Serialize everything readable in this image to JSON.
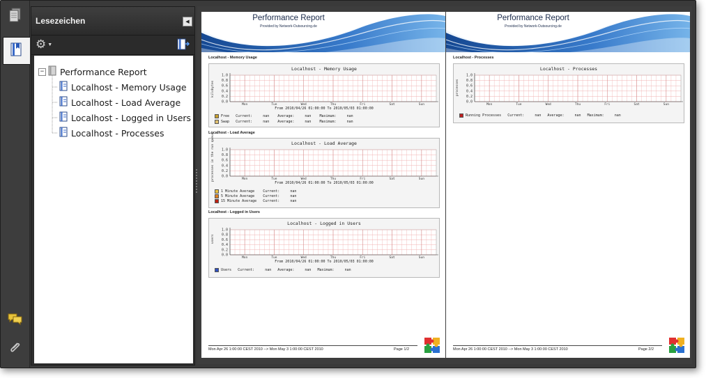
{
  "panel": {
    "title": "Lesezeichen",
    "collapse_glyph": "◀"
  },
  "rail_icons": [
    "pages-icon",
    "bookmarks-icon",
    "comments-icon",
    "attachments-icon"
  ],
  "tree": {
    "root": "Performance Report",
    "items": [
      "Localhost - Memory Usage",
      "Localhost - Load Average",
      "Localhost - Logged in Users",
      "Localhost - Processes"
    ]
  },
  "report": {
    "title": "Performance Report",
    "subtitle": "Provided by Network-Outsourcing.de",
    "footer_range": "Mon Apr 26 1:00:00 CEST 2010 --> Mon May 3 1:00:00 CEST 2010",
    "page1_label": "Page 1/2",
    "page2_label": "Page 2/2"
  },
  "sections": {
    "memory": {
      "heading": "Localhost - Memory Usage",
      "graph_title": "Localhost - Memory Usage",
      "ylabel": "kilobytes",
      "period": "From 2010/04/26 01:00:00 To 2010/05/03 01:00:00",
      "legend": [
        "Free   Current:     nan    Average:     nan    Maximum:     nan",
        "Swap   Current:     nan    Average:     nan    Maximum:     nan"
      ]
    },
    "load": {
      "heading": "Localhost - Load Average",
      "graph_title": "Localhost - Load Average",
      "ylabel": "processes in the run queue",
      "period": "From 2010/04/26 01:00:00 To 2010/05/03 01:00:00",
      "legend": [
        "1 Minute Average    Current:     nan",
        "5 Minute Average    Current:     nan",
        "15 Minute Average   Current:     nan"
      ]
    },
    "users": {
      "heading": "Localhost - Logged in Users",
      "graph_title": "Localhost - Logged in Users",
      "ylabel": "users",
      "period": "From 2010/04/26 01:00:00 To 2010/05/03 01:00:00",
      "legend": [
        "Users   Current:     nan   Average:     nan   Maximum:     nan"
      ]
    },
    "processes": {
      "heading": "Localhost - Processes",
      "graph_title": "Localhost - Processes",
      "ylabel": "processes",
      "legend": [
        "Running Processes   Current:     nan   Average:     nan   Maximum:     nan"
      ]
    }
  },
  "axes": {
    "yticks": [
      "0.0",
      "0.2",
      "0.4",
      "0.6",
      "0.8",
      "1.0"
    ],
    "xticks": [
      "Mon",
      "Tue",
      "Wed",
      "Thu",
      "Fri",
      "Sat",
      "Sun"
    ]
  },
  "colors": {
    "free": "#c8a030",
    "swap": "#e0c070",
    "load1": "#e8c040",
    "load5": "#e08020",
    "load15": "#c02010",
    "users": "#3050c0",
    "running": "#c02020",
    "grid": "#f0b0b0",
    "banner_dark": "#0a3f8c",
    "banner_light": "#6fb0e8"
  }
}
